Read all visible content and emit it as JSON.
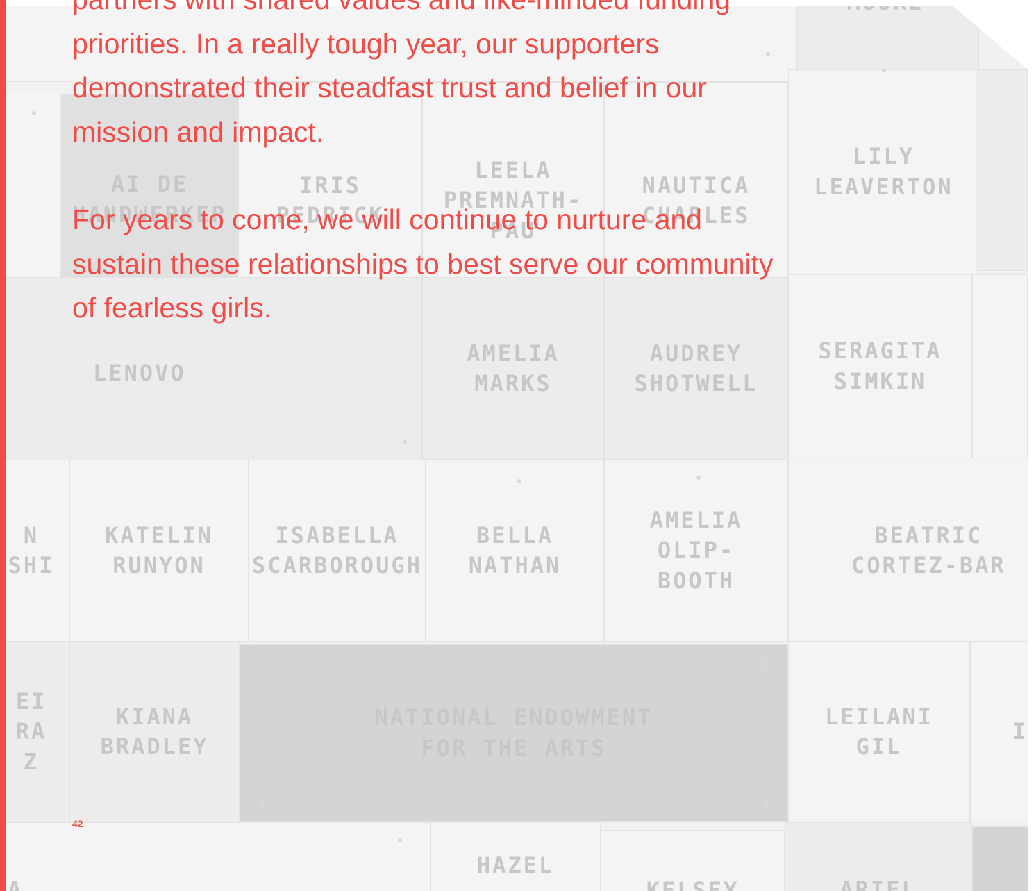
{
  "body": {
    "paragraph_1_fragment": "partners with shared values and like-minded funding priorities. In a really tough year, our supporters demonstrated their steadfast trust and belief in our mission and impact.",
    "paragraph_2": "For years to come, we will continue to nurture and sustain these relationships to best serve our community of fearless girls."
  },
  "page_number": "42",
  "plaques": {
    "top_right": "MOORE",
    "ai_de": "AI DE\nHANDWERKER",
    "iris": "IRIS\nPEDRICK",
    "leela": "LEELA\nPREMNATH-\nPAU",
    "nautica": "NAUTICA\nCHARLES",
    "lily": "LILY\nLEAVERTON",
    "lenovo": "LENOVO",
    "amelia_marks": "AMELIA\nMARKS",
    "audrey": "AUDREY\nSHOTWELL",
    "seragita": "SERAGITA\nSIMKIN",
    "left_partial_1": "N\nSHI",
    "katelin": "KATELIN\nRUNYON",
    "isabella": "ISABELLA\nSCARBOROUGH",
    "bella": "BELLA\nNATHAN",
    "amelia_olip": "AMELIA\nOLIP-\nBOOTH",
    "beatric": "BEATRIC\nCORTEZ-BAR",
    "left_partial_2": "EI\nRA\nZ",
    "kiana": "KIANA\nBRADLEY",
    "nea": "NATIONAL ENDOWMENT\nFOR THE ARTS",
    "leilani": "LEILANI\nGIL",
    "right_partial": "I",
    "hazel": "HAZEL",
    "kelsey": "KELSEY",
    "ariel": "ARIEL",
    "bottom_left": "A"
  },
  "colors": {
    "accent": "#f04b47"
  }
}
